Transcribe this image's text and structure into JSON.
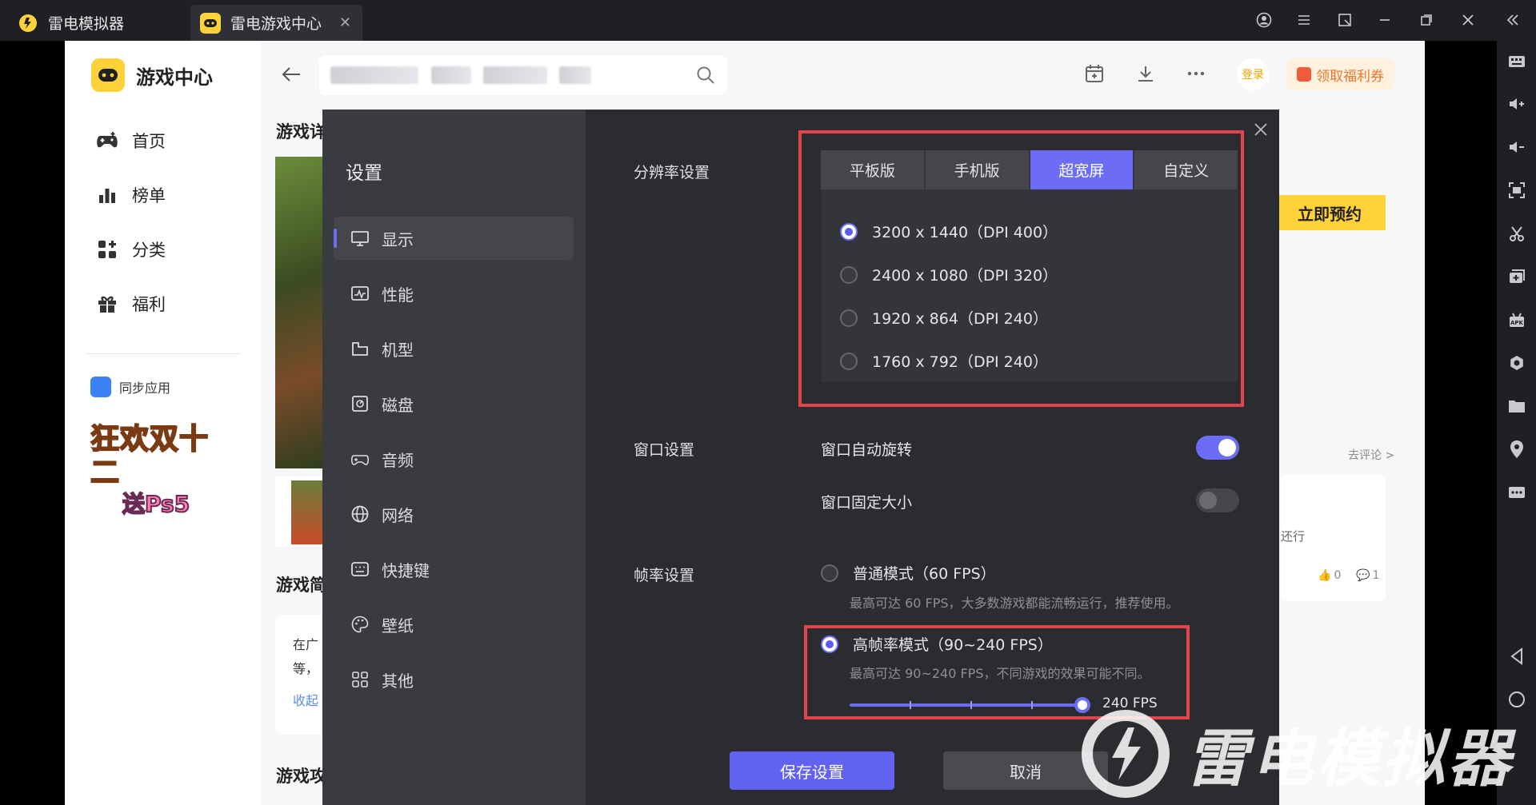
{
  "titlebar": {
    "tab1_title": "雷电模拟器",
    "tab2_title": "雷电游戏中心",
    "tab2_close": "✕"
  },
  "sidebar": {
    "brand": "游戏中心",
    "items": [
      {
        "label": "首页",
        "icon": "gamepad-icon"
      },
      {
        "label": "榜单",
        "icon": "chart-icon"
      },
      {
        "label": "分类",
        "icon": "category-icon"
      },
      {
        "label": "福利",
        "icon": "gift-icon"
      }
    ],
    "sync_label": "同步应用",
    "promo_line1": "狂欢双十二",
    "promo_line2": "送Ps5"
  },
  "header": {
    "login_label": "登录",
    "welfare_label": "领取福利券"
  },
  "background": {
    "section1_title": "游戏详",
    "section2_title": "游戏简",
    "section3_title": "游戏攻",
    "desc_line1": "在广",
    "desc_line2": "等，",
    "collapse": "收起",
    "reserve_button": "立即预约",
    "comment_link": "去评论 >",
    "comment_snippet": "还行",
    "like_count": "0",
    "reply_count": "1"
  },
  "settings": {
    "title": "设置",
    "nav": [
      {
        "label": "显示",
        "icon": "monitor-icon",
        "active": true
      },
      {
        "label": "性能",
        "icon": "performance-icon",
        "active": false
      },
      {
        "label": "机型",
        "icon": "device-icon",
        "active": false
      },
      {
        "label": "磁盘",
        "icon": "disk-icon",
        "active": false
      },
      {
        "label": "音频",
        "icon": "audio-icon",
        "active": false
      },
      {
        "label": "网络",
        "icon": "globe-icon",
        "active": false
      },
      {
        "label": "快捷键",
        "icon": "keyboard-icon",
        "active": false
      },
      {
        "label": "壁纸",
        "icon": "palette-icon",
        "active": false
      },
      {
        "label": "其他",
        "icon": "grid-icon",
        "active": false
      }
    ],
    "resolution": {
      "label": "分辨率设置",
      "tabs": [
        "平板版",
        "手机版",
        "超宽屏",
        "自定义"
      ],
      "active_tab": "超宽屏",
      "options": [
        {
          "label": "3200 x 1440（DPI 400）",
          "selected": true
        },
        {
          "label": "2400 x 1080（DPI 320）",
          "selected": false
        },
        {
          "label": "1920 x 864（DPI 240）",
          "selected": false
        },
        {
          "label": "1760 x 792（DPI 240）",
          "selected": false
        }
      ]
    },
    "window": {
      "label": "窗口设置",
      "auto_rotate": "窗口自动旋转",
      "auto_rotate_on": true,
      "fixed_size": "窗口固定大小",
      "fixed_size_on": false
    },
    "fps": {
      "label": "帧率设置",
      "normal_title": "普通模式（60 FPS）",
      "normal_desc": "最高可达 60 FPS，大多数游戏都能流畅运行，推荐使用。",
      "high_title": "高帧率模式（90~240 FPS）",
      "high_desc": "最高可达 90~240 FPS，不同游戏的效果可能不同。",
      "selected": "high",
      "slider_value": "240 FPS",
      "slider_fraction": 1.0
    },
    "save_button": "保存设置",
    "cancel_button": "取消"
  },
  "watermark": "雷电模拟器",
  "colors": {
    "accent": "#6c6cf5",
    "highlight_border": "#e4434b",
    "brand_yellow": "#ffd23a"
  }
}
